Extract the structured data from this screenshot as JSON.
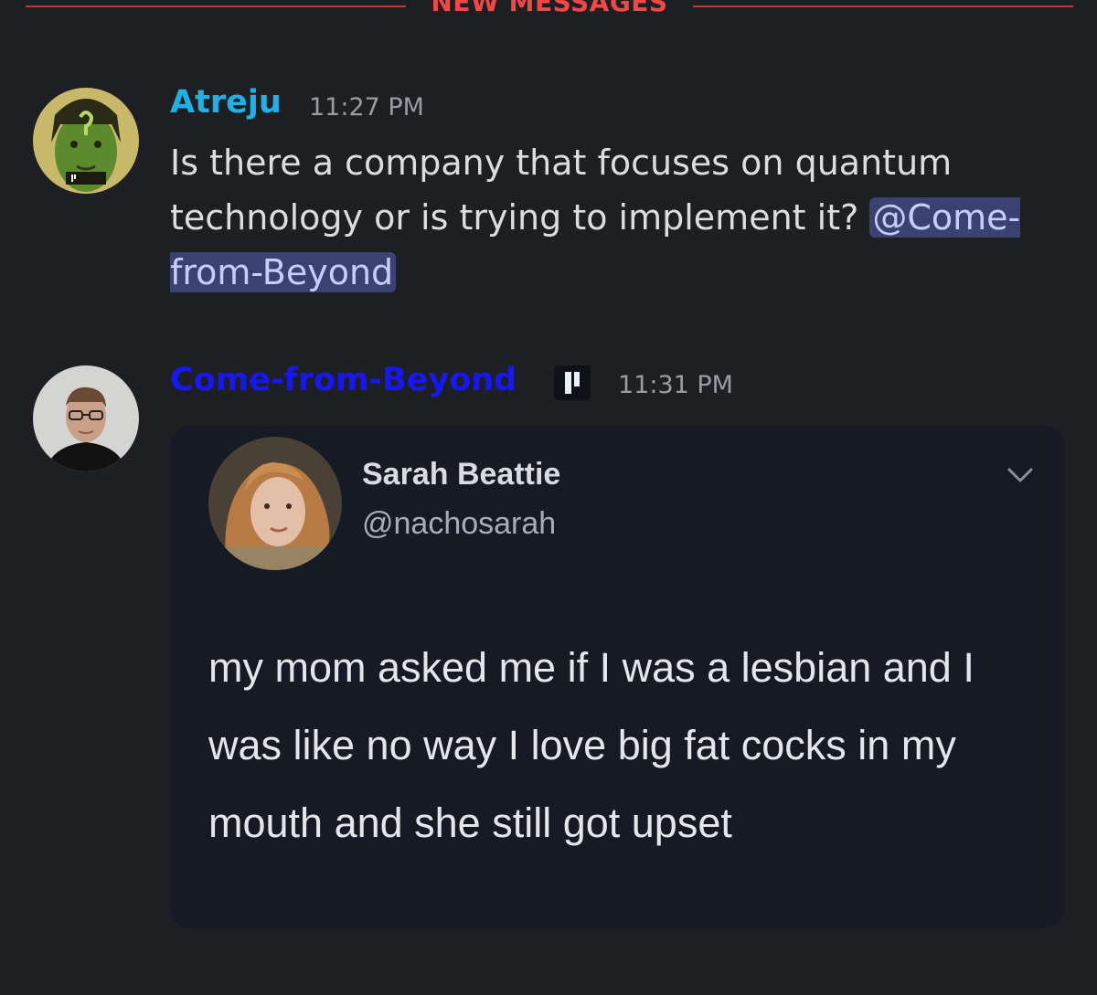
{
  "divider": {
    "label": "NEW MESSAGES"
  },
  "messages": [
    {
      "author": "Atreju",
      "author_color": "#1fb1e6",
      "timestamp": "11:27 PM",
      "avatar_badge": "QUBIC",
      "text_before": "Is there a company that focuses on quantum technology or is trying to implement it? ",
      "mention": "@Come-from-Beyond"
    },
    {
      "author": "Come-from-Beyond",
      "author_color": "#1717f5",
      "timestamp": "11:31 PM",
      "app_tag_icon": "qubic-icon",
      "embed": {
        "name": "Sarah Beattie",
        "handle": "@nachosarah",
        "text": "my mom asked me if I was a lesbian and I was like no way I love big fat cocks in my mouth and she still got upset",
        "menu_icon": "chevron-down-icon"
      }
    }
  ],
  "colors": {
    "background": "#1e1f23",
    "divider_red": "#f04747",
    "mention_bg": "#3c4270",
    "embed_bg": "#151a25"
  }
}
